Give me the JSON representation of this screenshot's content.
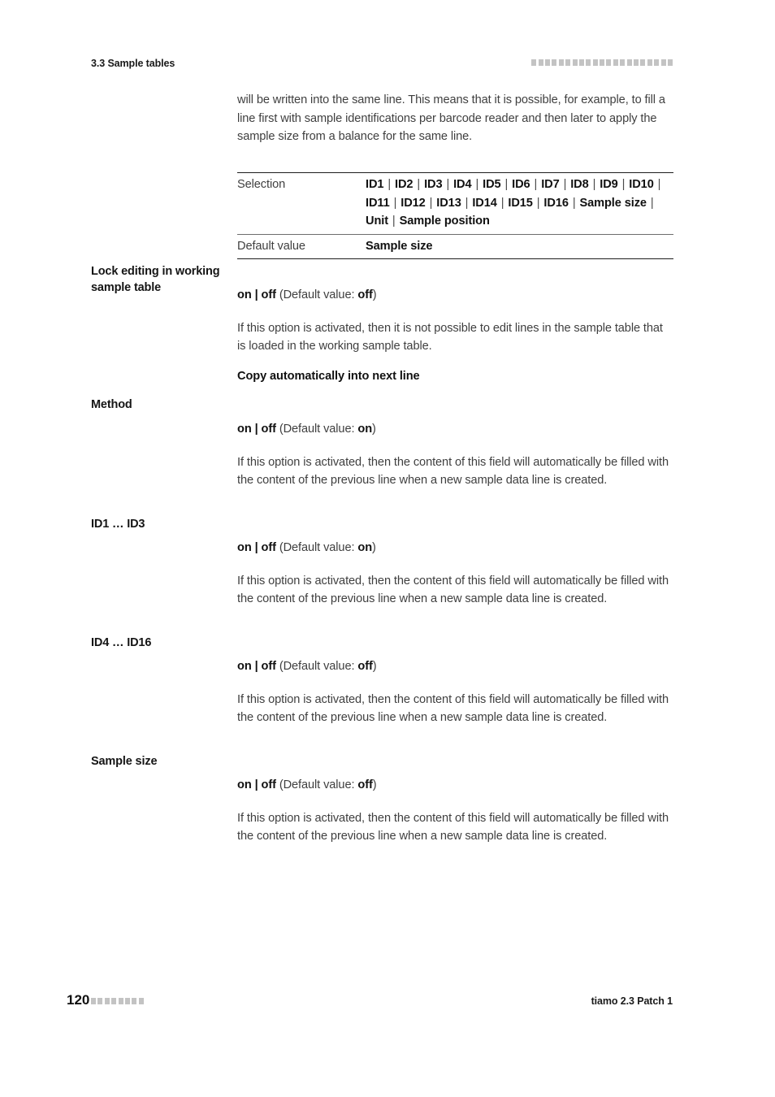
{
  "header": {
    "section_title": "3.3 Sample tables",
    "marker_squares": 21
  },
  "footer": {
    "page_number": "120",
    "marker_squares": 8,
    "product": "tiamo 2.3 Patch 1"
  },
  "intro": {
    "text": "will be written into the same line. This means that it is possible, for example, to fill a line first with sample identifications per barcode reader and then later to apply the sample size from a balance for the same line."
  },
  "spec_table": {
    "rows": [
      {
        "key": "Selection",
        "value": "ID1 | ID2 | ID3 | ID4 | ID5 | ID6 | ID7 | ID8 | ID9 | ID10 | ID11 | ID12 | ID13 | ID14 | ID15 | ID16 | Sample size | Unit | Sample position",
        "options": [
          "ID1",
          "ID2",
          "ID3",
          "ID4",
          "ID5",
          "ID6",
          "ID7",
          "ID8",
          "ID9",
          "ID10",
          "ID11",
          "ID12",
          "ID13",
          "ID14",
          "ID15",
          "ID16",
          "Sample size",
          "Unit",
          "Sample position"
        ]
      },
      {
        "key": "Default value",
        "value": "Sample size",
        "options": [
          "Sample size"
        ]
      }
    ]
  },
  "sections": [
    {
      "heading": "Lock editing in working sample table",
      "heading_position": "left",
      "values_bold": "on | off",
      "default_prefix": " (Default value: ",
      "default_value": "off",
      "default_suffix": ")",
      "description": "If this option is activated, then it is not possible to edit lines in the sample table that is loaded in the working sample table."
    },
    {
      "heading": "Copy automatically into next line",
      "heading_position": "right",
      "values_bold": "",
      "default_prefix": "",
      "default_value": "",
      "default_suffix": "",
      "description": ""
    },
    {
      "heading": "Method",
      "heading_position": "left",
      "values_bold": "on | off",
      "default_prefix": " (Default value: ",
      "default_value": "on",
      "default_suffix": ")",
      "description": "If this option is activated, then the content of this field will automatically be filled with the content of the previous line when a new sample data line is created."
    },
    {
      "heading": "ID1 … ID3",
      "heading_position": "left",
      "values_bold": "on | off",
      "default_prefix": " (Default value: ",
      "default_value": "on",
      "default_suffix": ")",
      "description": "If this option is activated, then the content of this field will automatically be filled with the content of the previous line when a new sample data line is created."
    },
    {
      "heading": "ID4 … ID16",
      "heading_position": "left",
      "values_bold": "on | off",
      "default_prefix": " (Default value: ",
      "default_value": "off",
      "default_suffix": ")",
      "description": "If this option is activated, then the content of this field will automatically be filled with the content of the previous line when a new sample data line is created."
    },
    {
      "heading": "Sample size",
      "heading_position": "left",
      "values_bold": "on | off",
      "default_prefix": " (Default value: ",
      "default_value": "off",
      "default_suffix": ")",
      "description": "If this option is activated, then the content of this field will automatically be filled with the content of the previous line when a new sample data line is created."
    }
  ]
}
